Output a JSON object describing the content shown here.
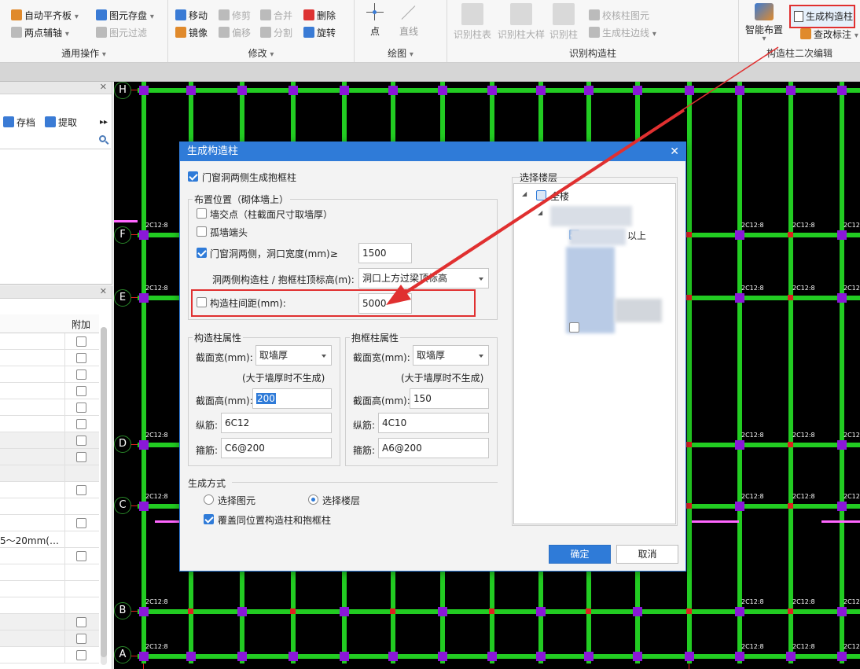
{
  "ribbon": {
    "general": {
      "label": "通用操作",
      "items": [
        "自动平齐板",
        "两点辅轴",
        "图元存盘",
        "图元过滤"
      ]
    },
    "modify": {
      "label": "修改",
      "items": [
        "移动",
        "修剪",
        "合并",
        "删除",
        "镜像",
        "偏移",
        "分割",
        "旋转"
      ]
    },
    "draw": {
      "label": "绘图",
      "items": [
        "点",
        "直线"
      ]
    },
    "identify": {
      "label": "识别构造柱",
      "items": [
        "识别柱表",
        "识别柱大样",
        "识别柱",
        "校核柱图元",
        "生成柱边线"
      ]
    },
    "secondary": {
      "label": "构造柱二次编辑",
      "smart_layout": "智能布置",
      "generate_col": "生成构造柱",
      "modify_label": "查改标注"
    }
  },
  "left_panel": {
    "save_label": "存档",
    "extract_label": "提取",
    "prop_header": "附加",
    "partial_text": "5～20mm(…"
  },
  "canvas": {
    "axes": [
      "H",
      "F",
      "E",
      "D",
      "C",
      "B",
      "A"
    ],
    "col_label": "2C12:8"
  },
  "dialog": {
    "title": "生成构造柱",
    "door_window_both_sides": "门窗洞两侧生成抱框柱",
    "placement_legend": "布置位置（砌体墙上）",
    "wall_intersection": "墙交点（柱截面尺寸取墙厚）",
    "isolated_wall_end": "孤墙端头",
    "door_window_width_label": "门窗洞两侧，洞口宽度(mm)≥",
    "door_window_width_value": "1500",
    "top_elev_label": "洞两侧构造柱 / 抱框柱顶标高(m):",
    "top_elev_value": "洞口上方过梁顶标高",
    "spacing_label": "构造柱间距(mm):",
    "spacing_value": "5000",
    "col_props": {
      "legend": "构造柱属性",
      "width_label": "截面宽(mm):",
      "width_value": "取墙厚",
      "note": "(大于墙厚时不生成)",
      "height_label": "截面高(mm):",
      "height_value": "200",
      "long_bar_label": "纵筋:",
      "long_bar_value": "6C12",
      "stirrup_label": "箍筋:",
      "stirrup_value": "C6@200"
    },
    "frame_props": {
      "legend": "抱框柱属性",
      "width_label": "截面宽(mm):",
      "width_value": "取墙厚",
      "note": "(大于墙厚时不生成)",
      "height_label": "截面高(mm):",
      "height_value": "150",
      "long_bar_label": "纵筋:",
      "long_bar_value": "4C10",
      "stirrup_label": "箍筋:",
      "stirrup_value": "A6@200"
    },
    "method_legend": "生成方式",
    "select_element": "选择图元",
    "select_floor": "选择楼层",
    "cover_same": "覆盖同位置构造柱和抱框柱",
    "floor_legend": "选择楼层",
    "tree_root": "全楼",
    "tree_partial": "以上",
    "ok": "确定",
    "cancel": "取消"
  },
  "colors": {
    "accent": "#2f7bd8",
    "highlight_red": "#e03030",
    "wall_green": "#22cc22",
    "column_purple": "#8a18d8"
  }
}
